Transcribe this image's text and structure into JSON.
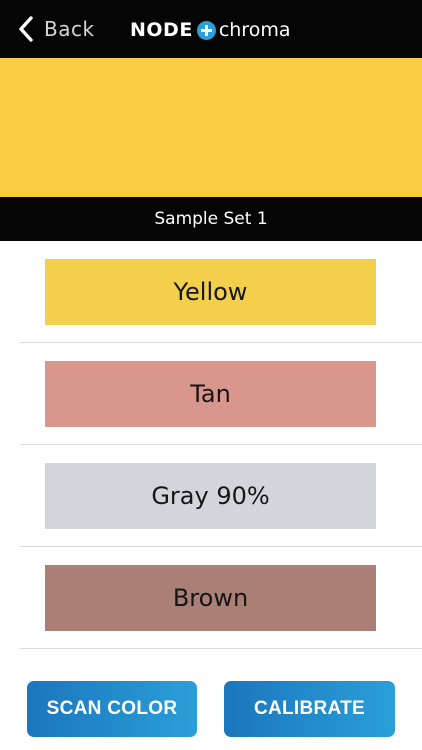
{
  "navbar": {
    "back_label": "Back",
    "back_icon": "chevron-left-icon",
    "logo_node": "NODE",
    "logo_plus_icon": "plus-circle-icon",
    "logo_chroma": "chroma"
  },
  "preview": {
    "color": "#fdcc46"
  },
  "sample_set": {
    "title": "Sample Set 1"
  },
  "swatches": [
    {
      "label": "Yellow",
      "color": "#f3cf4b"
    },
    {
      "label": "Tan",
      "color": "#d8968c"
    },
    {
      "label": "Gray 90%",
      "color": "#d2d6dc"
    },
    {
      "label": "Brown",
      "color": "#a97f76"
    }
  ],
  "actions": {
    "scan_label": "SCAN COLOR",
    "calibrate_label": "CALIBRATE"
  },
  "colors": {
    "navbar_bg": "#050505",
    "button_gradient_start": "#1b76bd",
    "button_gradient_end": "#2a9fd8"
  }
}
